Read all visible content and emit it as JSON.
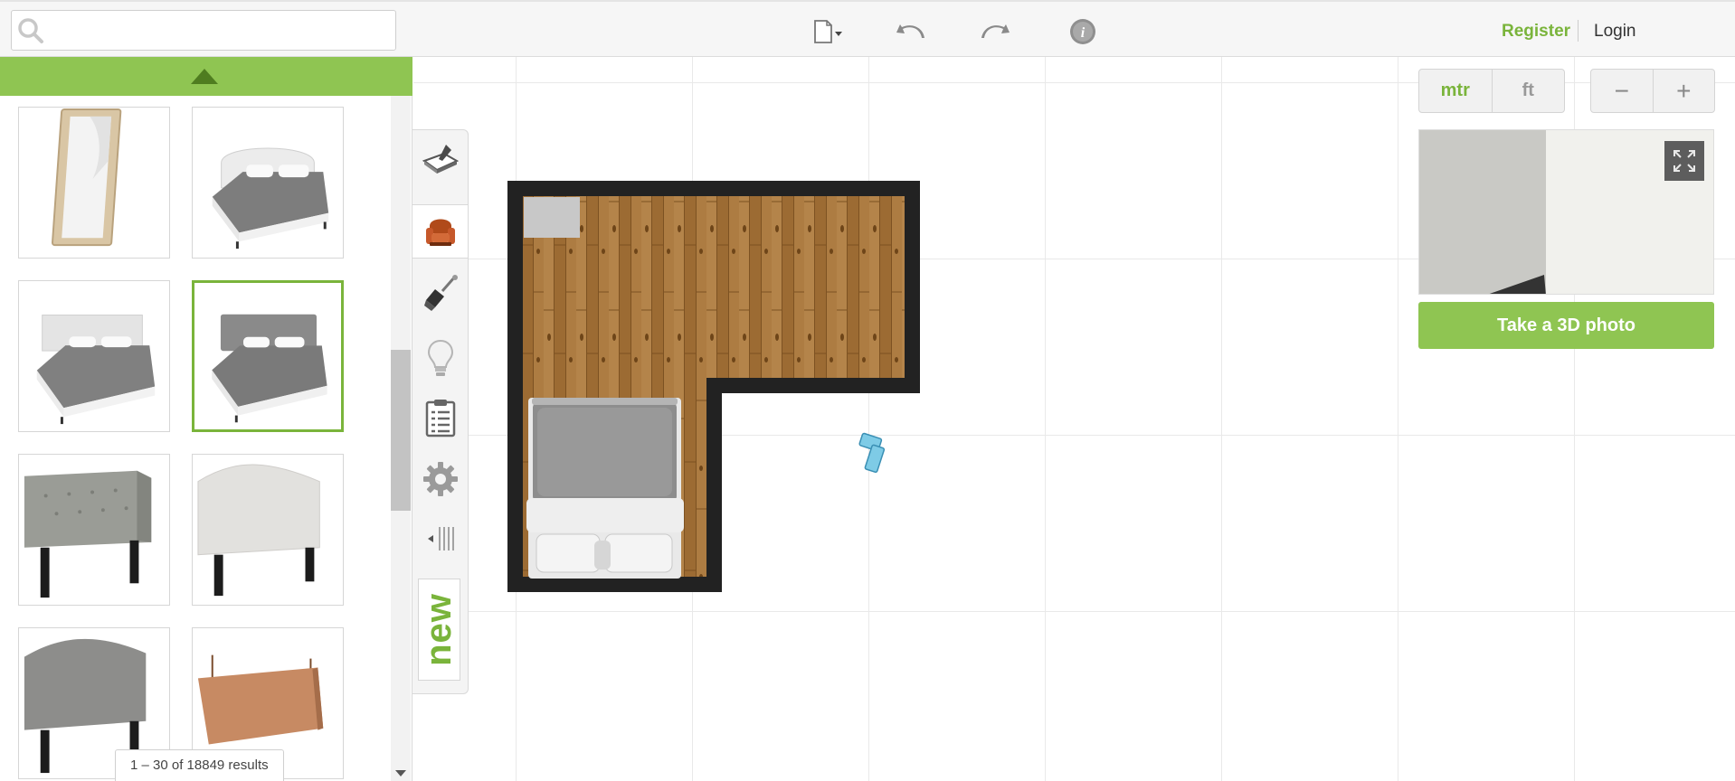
{
  "search": {
    "placeholder": "",
    "value": ""
  },
  "toolbar": {
    "icons": [
      "new-file-icon",
      "undo-icon",
      "redo-icon",
      "info-icon"
    ]
  },
  "auth": {
    "register": "Register",
    "login": "Login"
  },
  "catalog": {
    "items": [
      {
        "name": "floor-mirror",
        "icon": "mirror-thumbnail"
      },
      {
        "name": "upholstered-bed-white",
        "icon": "bed-thumbnail"
      },
      {
        "name": "upholstered-bed-panel",
        "icon": "bed-thumbnail"
      },
      {
        "name": "upholstered-bed-gray",
        "icon": "bed-thumbnail",
        "selected": true
      },
      {
        "name": "tufted-headboard-gray",
        "icon": "headboard-thumbnail"
      },
      {
        "name": "arched-headboard-white",
        "icon": "headboard-thumbnail"
      },
      {
        "name": "arched-headboard-gray",
        "icon": "headboard-thumbnail"
      },
      {
        "name": "hanging-headboard-leather",
        "icon": "headboard-thumbnail"
      }
    ],
    "results_text": "1 – 30 of 18849 results"
  },
  "side_strip": {
    "tools": [
      "build-tool-icon",
      "furniture-icon",
      "paint-brush-icon",
      "lightbulb-icon",
      "clipboard-icon",
      "settings-gear-icon",
      "collapse-icon"
    ],
    "active": "furniture-icon",
    "new_label": "new"
  },
  "units": {
    "metric": "mtr",
    "imperial": "ft",
    "active": "mtr"
  },
  "zoom": {
    "out": "−",
    "in": "+"
  },
  "preview": {
    "button_label": "Take a 3D photo"
  },
  "colors": {
    "accent": "#8fc552",
    "accent_text": "#7ab43b",
    "wall": "#222222",
    "floor": "#a8763c"
  }
}
